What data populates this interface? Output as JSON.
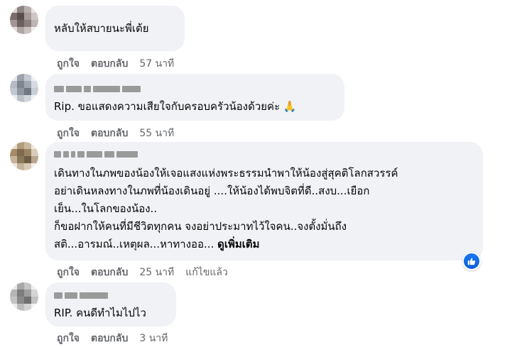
{
  "comments": [
    {
      "text_lines": [
        "หลับให้สบายนะพี่เต้ย"
      ],
      "actions": {
        "like": "ถูกใจ",
        "reply": "ตอบกลับ",
        "time": "57 นาที"
      }
    },
    {
      "text_lines": [
        "Rip. ขอแสดงความเสียใจกับครอบครัวน้องด้วยค่ะ"
      ],
      "emoji": "folded-hands-icon",
      "actions": {
        "like": "ถูกใจ",
        "reply": "ตอบกลับ",
        "time": "55 นาที"
      }
    },
    {
      "text_lines": [
        "เดินทางในภพของน้องให้เจอแสงแห่งพระธรรมนำพาให้น้องสู่สุคติโลกสวรรค์",
        "อย่าเดินหลงทางในภพที่น้องเดินอยู่ ....ให้น้องได้พบจิตที่ดี..สงบ...เยือก",
        "เย็น...ในโลกของน้อง..",
        "ก็ขอฝากให้คนที่มีชีวิตทุกคน จงอย่าประมาทไว้ใจคน..จงตั้งมั่นถึง",
        "สติ...อารมณ์..เหตุผล...หาทางออ..."
      ],
      "see_more": "ดูเพิ่มเติม",
      "reaction": "like-icon",
      "actions": {
        "like": "ถูกใจ",
        "reply": "ตอบกลับ",
        "time": "25 นาที",
        "edited": "แก้ไขแล้ว"
      }
    },
    {
      "text_lines": [
        "RIP. คนดีทำไมไปไว"
      ],
      "actions": {
        "like": "ถูกใจ",
        "reply": "ตอบกลับ",
        "time": "3 นาที"
      }
    }
  ],
  "colors": {
    "bubble": "#f0f2f5",
    "meta": "#65676b",
    "like_blue": "#1877f2"
  }
}
